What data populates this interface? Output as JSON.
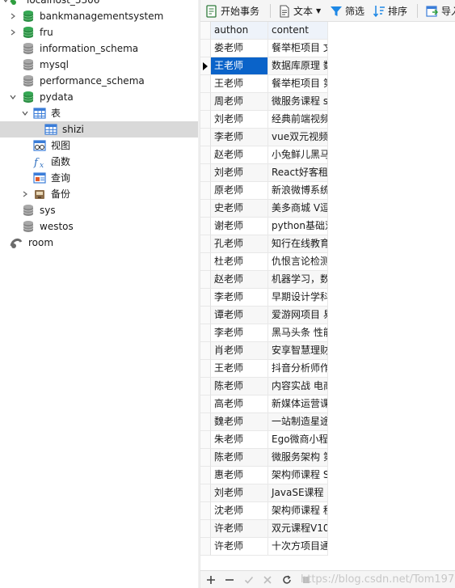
{
  "tree": {
    "connection_label": "localhost_3306",
    "items": [
      {
        "label": "bankmanagementsystem"
      },
      {
        "label": "fru"
      },
      {
        "label": "information_schema"
      },
      {
        "label": "mysql"
      },
      {
        "label": "performance_schema"
      },
      {
        "label": "pydata"
      },
      {
        "label": "表"
      },
      {
        "label": "shizi"
      },
      {
        "label": "视图"
      },
      {
        "label": "函数"
      },
      {
        "label": "查询"
      },
      {
        "label": "备份"
      },
      {
        "label": "sys"
      },
      {
        "label": "westos"
      },
      {
        "label": "room"
      }
    ]
  },
  "toolbar": {
    "begin_transaction": "开始事务",
    "text": "文本",
    "filter": "筛选",
    "sort": "排序",
    "import": "导入"
  },
  "grid": {
    "columns": [
      "authon",
      "content"
    ],
    "rows": [
      [
        "娄老师",
        "餐举柜项目 文"
      ],
      [
        "王老师",
        "数据库原理 数"
      ],
      [
        "王老师",
        "餐举柜项目 第"
      ],
      [
        "周老师",
        "微服务课程 s"
      ],
      [
        "刘老师",
        "经典前端视频"
      ],
      [
        "李老师",
        "vue双元视频"
      ],
      [
        "赵老师",
        "小兔鲜儿黑马"
      ],
      [
        "刘老师",
        "React好客租房"
      ],
      [
        "原老师",
        "新浪微博系统"
      ],
      [
        "史老师",
        "美多商城 V逗"
      ],
      [
        "谢老师",
        "python基础双"
      ],
      [
        "孔老师",
        "知行在线教育"
      ],
      [
        "杜老师",
        "仇恨言论检测"
      ],
      [
        "赵老师",
        "机器学习，数"
      ],
      [
        "李老师",
        "早期设计学科"
      ],
      [
        "谭老师",
        "爱游网项目 易"
      ],
      [
        "李老师",
        "黑马头条 性能"
      ],
      [
        "肖老师",
        "安享智慧理财"
      ],
      [
        "王老师",
        "抖音分析师作"
      ],
      [
        "陈老师",
        "内容实战 电商"
      ],
      [
        "高老师",
        "新媒体运营课"
      ],
      [
        "魏老师",
        "一站制造星途"
      ],
      [
        "朱老师",
        "Ego微商小程"
      ],
      [
        "陈老师",
        "微服务架构 第"
      ],
      [
        "惠老师",
        "架构师课程 S"
      ],
      [
        "刘老师",
        "JavaSE课程 第"
      ],
      [
        "沈老师",
        "架构师课程 秒"
      ],
      [
        "许老师",
        "双元课程V10"
      ],
      [
        "许老师",
        "十次方项目通"
      ]
    ]
  },
  "watermark": "https://blog.csdn.net/Tom197"
}
